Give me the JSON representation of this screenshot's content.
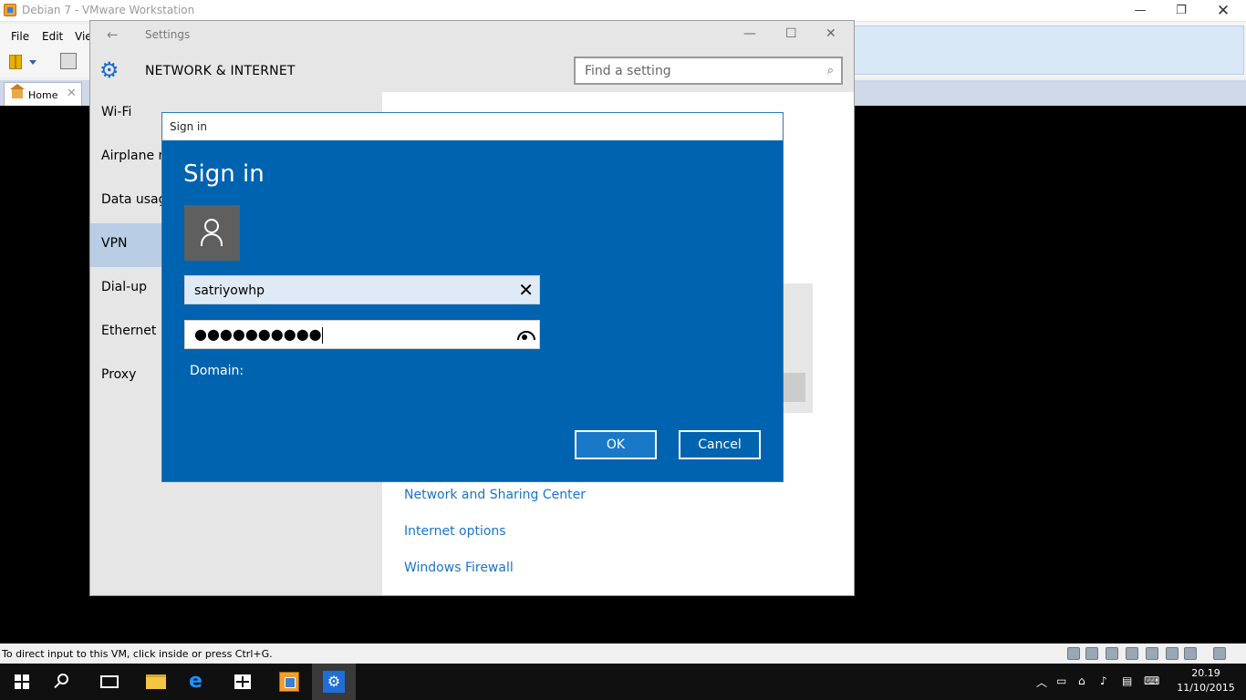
{
  "vmware": {
    "window_title": "Debian 7 - VMware Workstation",
    "menu": [
      "File",
      "Edit",
      "Vie"
    ],
    "home_tab": "Home",
    "status_text": "To direct input to this VM, click inside or press Ctrl+G."
  },
  "settings": {
    "window_title": "Settings",
    "section_title": "NETWORK & INTERNET",
    "search_placeholder": "Find a setting",
    "nav_items": [
      {
        "label": "Wi-Fi",
        "selected": false
      },
      {
        "label": "Airplane m",
        "selected": false
      },
      {
        "label": "Data usag",
        "selected": false
      },
      {
        "label": "VPN",
        "selected": true
      },
      {
        "label": "Dial-up",
        "selected": false
      },
      {
        "label": "Ethernet",
        "selected": false
      },
      {
        "label": "Proxy",
        "selected": false
      }
    ],
    "links": [
      "Network and Sharing Center",
      "Internet options",
      "Windows Firewall"
    ]
  },
  "signin": {
    "dialog_title": "Sign in",
    "heading": "Sign in",
    "username_value": "satriyowhp",
    "password_masked": "●●●●●●●●●●",
    "domain_label": "Domain:",
    "ok_label": "OK",
    "cancel_label": "Cancel"
  },
  "taskbar": {
    "time": "20.19",
    "date": "11/10/2015"
  },
  "colors": {
    "dialog_blue": "#0063af",
    "link_blue": "#1a73c9",
    "nav_selected": "#b9cde5"
  }
}
